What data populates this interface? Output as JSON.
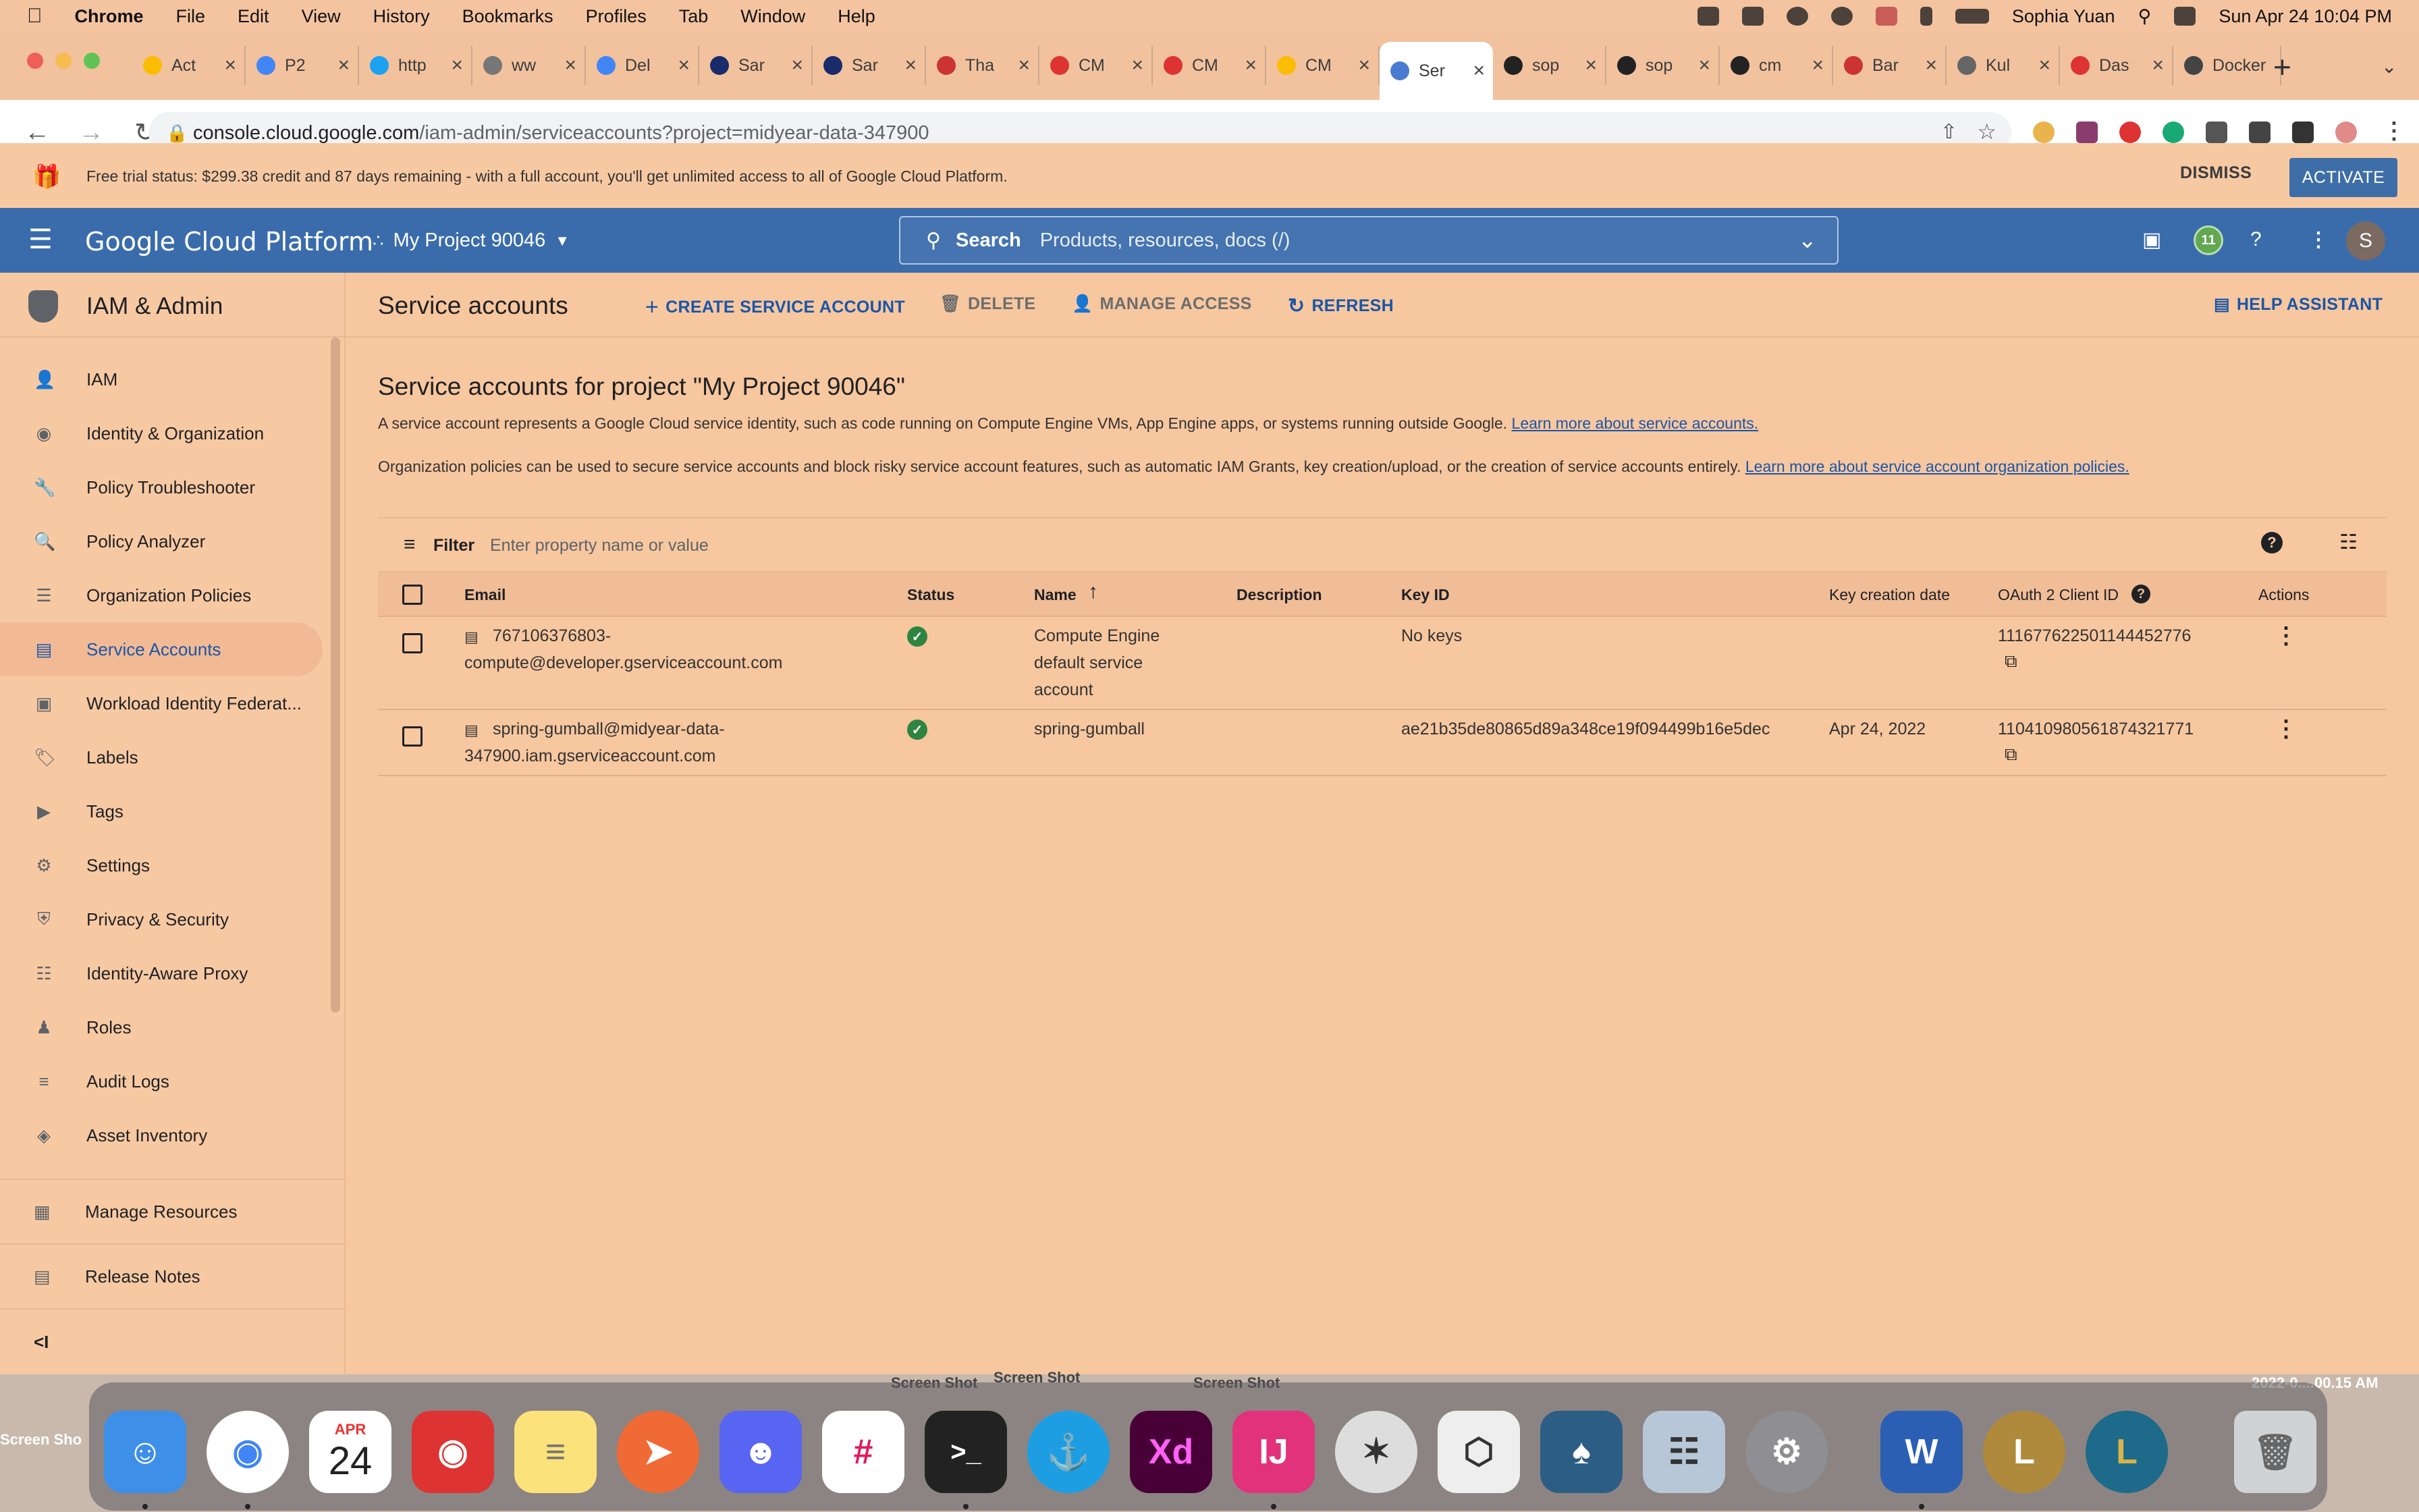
{
  "menubar": {
    "app": "Chrome",
    "items": [
      "File",
      "Edit",
      "View",
      "History",
      "Bookmarks",
      "Profiles",
      "Tab",
      "Window",
      "Help"
    ],
    "user": "Sophia Yuan",
    "datetime": "Sun Apr 24  10:04 PM"
  },
  "tabs": [
    {
      "title": "Act"
    },
    {
      "title": "P2"
    },
    {
      "title": "http"
    },
    {
      "title": "ww"
    },
    {
      "title": "Del"
    },
    {
      "title": "Sar"
    },
    {
      "title": "Sar"
    },
    {
      "title": "Tha"
    },
    {
      "title": "CM"
    },
    {
      "title": "CM"
    },
    {
      "title": "CM"
    },
    {
      "title": "Ser"
    },
    {
      "title": "sop"
    },
    {
      "title": "sop"
    },
    {
      "title": "cm"
    },
    {
      "title": "Bar"
    },
    {
      "title": "Kul"
    },
    {
      "title": "Das"
    },
    {
      "title": "Docker"
    }
  ],
  "url": {
    "host": "console.cloud.google.com",
    "path": "/iam-admin/serviceaccounts?project=midyear-data-347900"
  },
  "banner": {
    "message": "Free trial status: $299.38 credit and 87 days remaining - with a full account, you'll get unlimited access to all of Google Cloud Platform.",
    "dismiss": "DISMISS",
    "activate": "ACTIVATE"
  },
  "header": {
    "brand": "Google Cloud Platform",
    "project": "My Project 90046",
    "search_label": "Search",
    "search_placeholder": "Products, resources, docs (/)",
    "notif_count": "11",
    "avatar_initial": "S"
  },
  "sidebar": {
    "title": "IAM & Admin",
    "items": [
      {
        "label": "IAM",
        "icon": "person-add-icon"
      },
      {
        "label": "Identity & Organization",
        "icon": "account-circle-icon"
      },
      {
        "label": "Policy Troubleshooter",
        "icon": "wrench-icon"
      },
      {
        "label": "Policy Analyzer",
        "icon": "document-search-icon"
      },
      {
        "label": "Organization Policies",
        "icon": "list-doc-icon"
      },
      {
        "label": "Service Accounts",
        "icon": "service-account-icon",
        "selected": true
      },
      {
        "label": "Workload Identity Federat...",
        "icon": "id-card-icon"
      },
      {
        "label": "Labels",
        "icon": "label-icon"
      },
      {
        "label": "Tags",
        "icon": "tag-icon"
      },
      {
        "label": "Settings",
        "icon": "gear-icon"
      },
      {
        "label": "Privacy & Security",
        "icon": "shield-icon"
      },
      {
        "label": "Identity-Aware Proxy",
        "icon": "proxy-icon"
      },
      {
        "label": "Roles",
        "icon": "roles-icon"
      },
      {
        "label": "Audit Logs",
        "icon": "lines-icon"
      },
      {
        "label": "Asset Inventory",
        "icon": "diamond-icon"
      }
    ],
    "manage_resources": "Manage Resources",
    "release_notes": "Release Notes"
  },
  "toolbar": {
    "title": "Service accounts",
    "create": "CREATE SERVICE ACCOUNT",
    "delete": "DELETE",
    "manage_access": "MANAGE ACCESS",
    "refresh": "REFRESH",
    "help_assistant": "HELP ASSISTANT"
  },
  "content": {
    "heading": "Service accounts for project \"My Project 90046\"",
    "para1": "A service account represents a Google Cloud service identity, such as code running on Compute Engine VMs, App Engine apps, or systems running outside Google.",
    "para1_link": "Learn more about service accounts.",
    "para2": "Organization policies can be used to secure service accounts and block risky service account features, such as automatic IAM Grants, key creation/upload, or the creation of service accounts entirely.",
    "para2_link": "Learn more about service account organization policies."
  },
  "table": {
    "filter_label": "Filter",
    "filter_placeholder": "Enter property name or value",
    "columns": [
      "Email",
      "Status",
      "Name",
      "Description",
      "Key ID",
      "Key creation date",
      "OAuth 2 Client ID",
      "Actions"
    ],
    "rows": [
      {
        "email_line1": "767106376803-",
        "email_line2": "compute@developer.gserviceaccount.com",
        "name_line1": "Compute Engine",
        "name_line2": "default service",
        "name_line3": "account",
        "description": "",
        "key_id": "No keys",
        "key_date": "",
        "client_id": "111677622501144452776"
      },
      {
        "email_line1": "spring-gumball@midyear-data-",
        "email_line2": "347900.iam.gserviceaccount.com",
        "name_line1": "spring-gumball",
        "name_line2": "",
        "name_line3": "",
        "description": "",
        "key_id": "ae21b35de80865d89a348ce19f094499b16e5dec",
        "key_date": "Apr 24, 2022",
        "client_id": "110410980561874321771"
      }
    ]
  },
  "dock": {
    "calendar_month": "APR",
    "calendar_day": "24"
  },
  "desktop": {
    "shot1": "Screen Shot",
    "shot2": "Screen Shot",
    "shot3": "Screen Shot",
    "shot4": "Screen Sho",
    "shot5": "2022-0....00.15 AM"
  }
}
